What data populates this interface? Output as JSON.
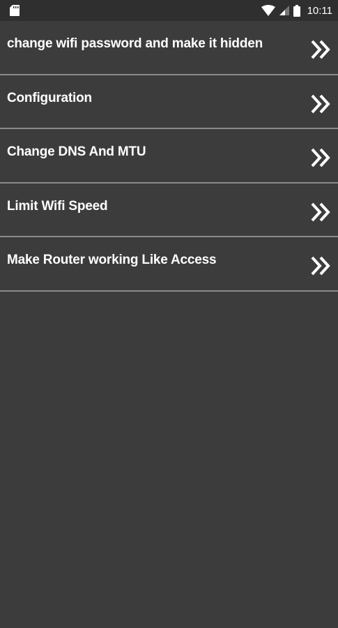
{
  "status_bar": {
    "time": "10:11",
    "icons": [
      "sd-card-icon",
      "wifi-icon",
      "signal-icon",
      "battery-icon"
    ]
  },
  "menu": {
    "items": [
      {
        "label": "change wifi password and make it hidden",
        "icon": "double-chevron-right-icon"
      },
      {
        "label": "Configuration",
        "icon": "double-chevron-right-icon"
      },
      {
        "label": "Change DNS And MTU",
        "icon": "double-chevron-right-icon"
      },
      {
        "label": "Limit Wifi Speed",
        "icon": "double-chevron-right-icon"
      },
      {
        "label": "Make Router working Like Access",
        "icon": "double-chevron-right-icon"
      }
    ]
  },
  "colors": {
    "background": "#3c3c3c",
    "status_bar": "#2f2f2f",
    "divider": "#8a8a8a",
    "text": "#ffffff"
  }
}
